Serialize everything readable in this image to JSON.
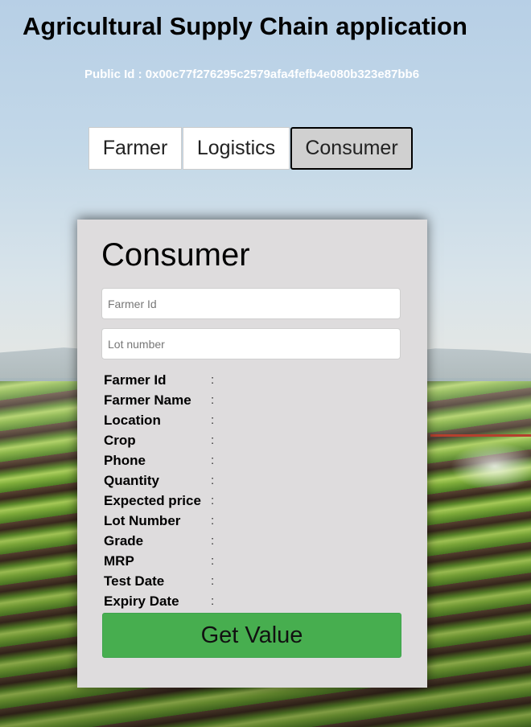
{
  "app": {
    "title": "Agricultural Supply Chain application",
    "public_id": "Public Id : 0x00c77f276295c2579afa4fefb4e080b323e87bb6"
  },
  "tabs": [
    {
      "label": "Farmer",
      "active": false
    },
    {
      "label": "Logistics",
      "active": false
    },
    {
      "label": "Consumer",
      "active": true
    }
  ],
  "consumer_form": {
    "title": "Consumer",
    "farmer_id_input": {
      "placeholder": "Farmer Id",
      "value": ""
    },
    "lot_number_input": {
      "placeholder": "Lot number",
      "value": ""
    },
    "separator": ":",
    "fields": [
      {
        "label": "Farmer Id",
        "value": ""
      },
      {
        "label": "Farmer Name",
        "value": ""
      },
      {
        "label": "Location",
        "value": ""
      },
      {
        "label": "Crop",
        "value": ""
      },
      {
        "label": "Phone",
        "value": ""
      },
      {
        "label": "Quantity",
        "value": ""
      },
      {
        "label": "Expected price",
        "value": ""
      },
      {
        "label": "Lot Number",
        "value": ""
      },
      {
        "label": "Grade",
        "value": ""
      },
      {
        "label": "MRP",
        "value": ""
      },
      {
        "label": "Test Date",
        "value": ""
      },
      {
        "label": "Expiry Date",
        "value": ""
      }
    ],
    "submit_label": "Get Value"
  },
  "colors": {
    "button_green": "#47ae4f",
    "card_background": "#dedcdd",
    "active_tab": "#d0d0d0"
  }
}
